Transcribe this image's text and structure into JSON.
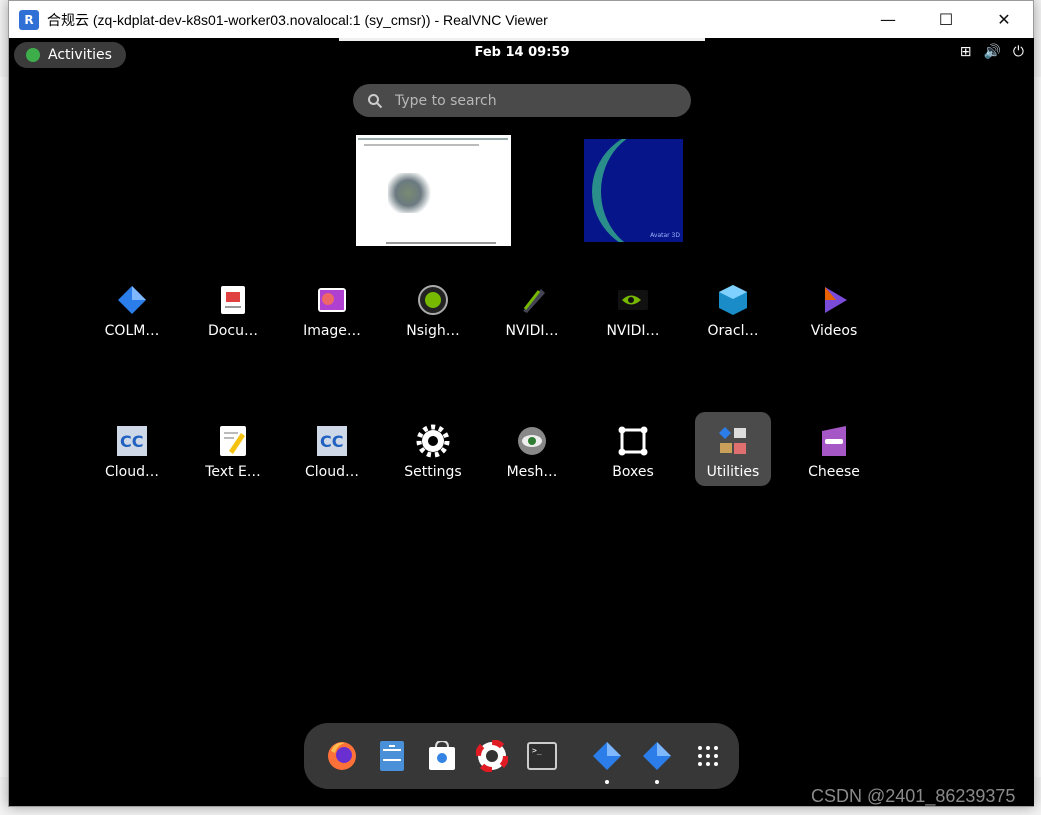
{
  "window": {
    "title": "合规云 (zq-kdplat-dev-k8s01-worker03.novalocal:1 (sy_cmsr)) - RealVNC Viewer",
    "app_icon": "realvnc-icon",
    "app_icon_glyph": "R",
    "controls": {
      "minimize": "—",
      "maximize": "☐",
      "close": "✕"
    }
  },
  "topbar": {
    "activities_label": "Activities",
    "clock": "Feb 14  09:59",
    "tray_icons": [
      "network-icon",
      "volume-icon",
      "power-icon"
    ],
    "tray_glyphs": [
      "⊞",
      "🔊",
      "⏻"
    ]
  },
  "search": {
    "placeholder": "Type to search"
  },
  "previews": {
    "model_label": "Avatar 3D"
  },
  "apps_row1": [
    {
      "label": "COLM…",
      "icon": "colmap-icon",
      "color": "#2b7de9"
    },
    {
      "label": "Docu…",
      "icon": "document-viewer-icon",
      "color": "#e04040"
    },
    {
      "label": "Image…",
      "icon": "image-viewer-icon",
      "color": "#b040d0"
    },
    {
      "label": "Nsigh…",
      "icon": "nsight-icon",
      "color": "#76b900"
    },
    {
      "label": "NVIDI…",
      "icon": "nvidia-graphics-icon",
      "color": "#76b900"
    },
    {
      "label": "NVIDI…",
      "icon": "nvidia-settings-icon",
      "color": "#76b900"
    },
    {
      "label": "Oracl…",
      "icon": "virtualbox-icon",
      "color": "#1a8cc8"
    },
    {
      "label": "Videos",
      "icon": "videos-icon",
      "color": "#7a4bd8"
    }
  ],
  "apps_row2": [
    {
      "label": "Cloud…",
      "icon": "cloudcompare-icon",
      "color": "#2060c0"
    },
    {
      "label": "Text E…",
      "icon": "text-editor-icon",
      "color": "#f5c211"
    },
    {
      "label": "Cloud…",
      "icon": "cloudcompare-viewer-icon",
      "color": "#2060c0"
    },
    {
      "label": "Settings",
      "icon": "settings-gear-icon",
      "color": "#ffffff"
    },
    {
      "label": "Mesh…",
      "icon": "meshlab-icon",
      "color": "#cccccc"
    },
    {
      "label": "Boxes",
      "icon": "boxes-icon",
      "color": "#ffffff"
    },
    {
      "label": "Utilities",
      "icon": "utilities-folder-icon",
      "color": "#5ba3e8"
    },
    {
      "label": "Cheese",
      "icon": "cheese-icon",
      "color": "#a657c6"
    }
  ],
  "dock": [
    {
      "name": "firefox-icon",
      "running": false
    },
    {
      "name": "files-icon",
      "running": false
    },
    {
      "name": "software-icon",
      "running": false
    },
    {
      "name": "help-icon",
      "running": false
    },
    {
      "name": "terminal-icon",
      "running": false
    },
    {
      "name": "colmap-icon",
      "running": true
    },
    {
      "name": "colmap-icon",
      "running": true
    },
    {
      "name": "show-apps-grid-icon",
      "running": false
    }
  ],
  "watermark": "CSDN @2401_86239375"
}
